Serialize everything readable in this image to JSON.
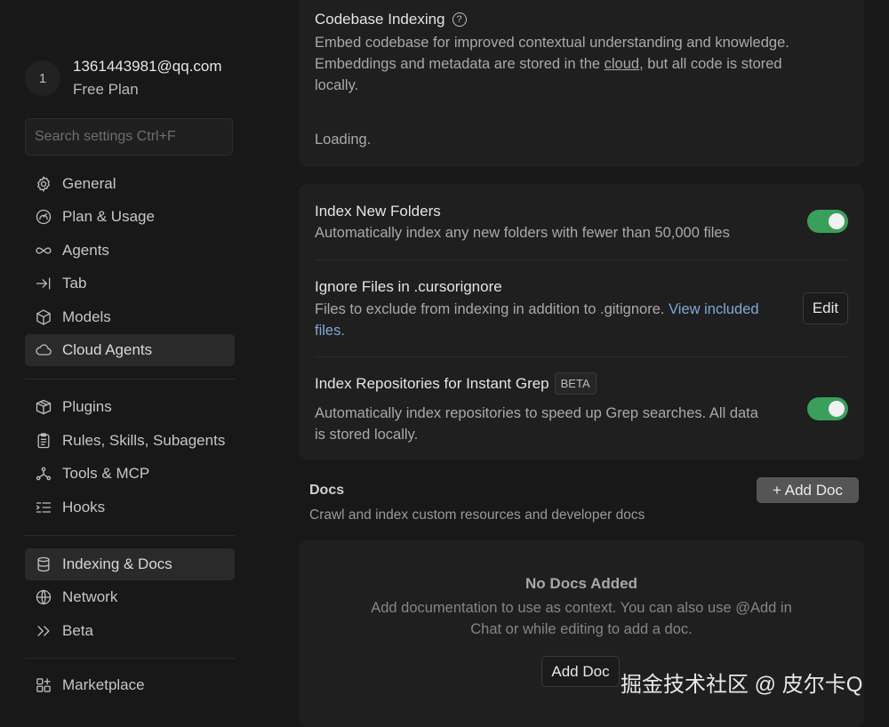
{
  "user": {
    "avatar_initial": "1",
    "email": "1361443981@qq.com",
    "plan": "Free Plan"
  },
  "search": {
    "placeholder": "Search settings Ctrl+F"
  },
  "sidebar": {
    "group1": [
      {
        "label": "General",
        "icon": "gear-icon"
      },
      {
        "label": "Plan & Usage",
        "icon": "gauge-icon"
      },
      {
        "label": "Agents",
        "icon": "infinity-icon"
      },
      {
        "label": "Tab",
        "icon": "tab-arrow-icon"
      },
      {
        "label": "Models",
        "icon": "cube-icon"
      },
      {
        "label": "Cloud Agents",
        "icon": "cloud-icon",
        "active": true
      }
    ],
    "group2": [
      {
        "label": "Plugins",
        "icon": "package-icon"
      },
      {
        "label": "Rules, Skills, Subagents",
        "icon": "clipboard-icon"
      },
      {
        "label": "Tools & MCP",
        "icon": "nodes-icon"
      },
      {
        "label": "Hooks",
        "icon": "list-hook-icon"
      }
    ],
    "group3": [
      {
        "label": "Indexing & Docs",
        "icon": "database-icon",
        "active": true
      },
      {
        "label": "Network",
        "icon": "globe-icon"
      },
      {
        "label": "Beta",
        "icon": "chevrons-right-icon"
      }
    ],
    "group4": [
      {
        "label": "Marketplace",
        "icon": "grid-plus-icon"
      }
    ]
  },
  "codebase": {
    "title": "Codebase Indexing",
    "desc_before": "Embed codebase for improved contextual understanding and knowledge. Embeddings and metadata are stored in the ",
    "desc_link": "cloud",
    "desc_after": ", but all code is stored locally.",
    "status": "Loading."
  },
  "settings": {
    "new_folders": {
      "title": "Index New Folders",
      "desc": "Automatically index any new folders with fewer than 50,000 files",
      "enabled": true
    },
    "ignore": {
      "title": "Ignore Files in .cursorignore",
      "desc": "Files to exclude from indexing in addition to .gitignore.",
      "link": "View included files.",
      "button": "Edit"
    },
    "grep": {
      "title": "Index Repositories for Instant Grep",
      "badge": "BETA",
      "desc": "Automatically index repositories to speed up Grep searches. All data is stored locally.",
      "enabled": true
    }
  },
  "docs": {
    "heading": "Docs",
    "subheading": "Crawl and index custom resources and developer docs",
    "add_button": "+ Add Doc",
    "empty_title": "No Docs Added",
    "empty_desc": "Add documentation to use as context. You can also use @Add in Chat or while editing to add a doc.",
    "empty_button": "Add Doc"
  },
  "watermark": "掘金技术社区 @ 皮尔卡Q",
  "colors": {
    "toggle_on": "#3a9f5b",
    "link": "#7fa8d8",
    "background": "#181818",
    "card": "#1f1f1f"
  }
}
